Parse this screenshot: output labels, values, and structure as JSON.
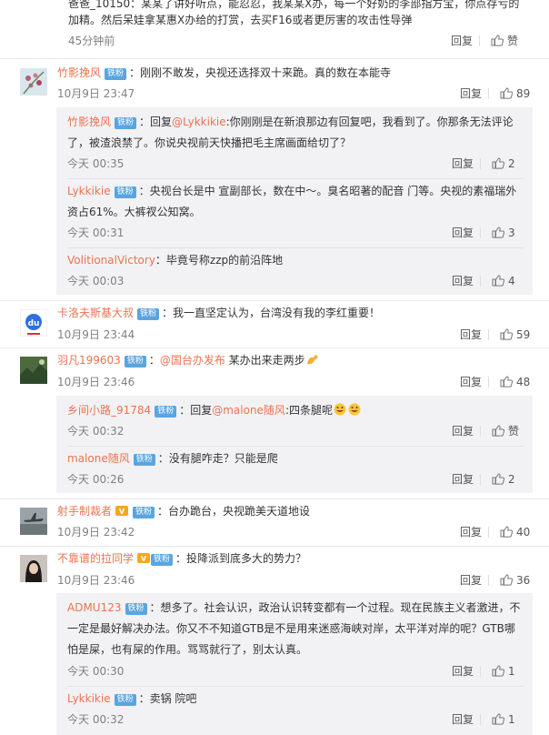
{
  "top": {
    "partial_text_1": "爸爸_10150：某某了讲好听点，能忍忍，我某某X办，每一个好奶的李部指方宝，你点存亏的",
    "partial_text_2": "加精。然后呆娃拿某惠X办给的打赏，去买F16或者更厉害的攻击性导弹",
    "time": "45分钟前",
    "reply": "回复",
    "like": "赞"
  },
  "comments": [
    {
      "name": "竹影挽风",
      "badge": "铁粉",
      "text": "：刚刚不敢发，央视还选择双十来跪。真的数在本能寺",
      "time": "10月9日 23:47",
      "reply": "回复",
      "likes": "89",
      "replies": [
        {
          "name": "竹影挽风",
          "badge": "铁粉",
          "pre": "：回复",
          "mention": "@Lykkikie",
          "text1": ":你刚刚是在新浪那边有回复吧，我看到了。你那条无法评论",
          "text2": "了，被渣浪禁了。你说央视前天快播把毛主席画面给切了？",
          "time": "今天 00:35",
          "reply": "回复",
          "likes": "2"
        },
        {
          "name": "Lykkikie",
          "badge": "铁粉",
          "text1": "：央视台长是中 宣副部长，数在中～。臭名昭著的配音 门等。央视的素福瑞外",
          "text2": "资占61%。大裤衩公知窝。",
          "time": "今天 00:31",
          "reply": "回复",
          "likes": "3"
        },
        {
          "name": "VolitionalVictory",
          "text1": "：毕竟号称zzp的前沿阵地",
          "time": "今天 00:03",
          "reply": "回复",
          "likes": "4"
        }
      ]
    },
    {
      "name": "卡洛夫斯基大叔",
      "badge": "铁粉",
      "text": "：我一直坚定认为，台湾没有我的李红重要！",
      "time": "10月9日 23:44",
      "reply": "回复",
      "likes": "59"
    },
    {
      "name": "羽凡199603",
      "badge": "铁粉",
      "pre": "：",
      "mention": "@国台办发布",
      "text": " 某办出来走两步",
      "time": "10月9日 23:46",
      "reply": "回复",
      "likes": "48",
      "replies": [
        {
          "name": "乡间小路_91784",
          "badge": "铁粉",
          "pre": "：回复",
          "mention": "@malone随风",
          "text1": ":四条腿呢",
          "time": "今天 00:32",
          "reply": "回复",
          "likes": "赞"
        },
        {
          "name": "malone随风",
          "badge": "铁粉",
          "text1": "：没有腿咋走？只能是爬",
          "time": "今天 00:26",
          "reply": "回复",
          "likes": "2"
        }
      ]
    },
    {
      "name": "射手制裁者",
      "badge": "铁粉",
      "text": "：台办跪台，央视跪美天道地设",
      "time": "10月9日 23:42",
      "reply": "回复",
      "likes": "40"
    },
    {
      "name": "不靠谱的拉同学",
      "badge": "铁粉",
      "text": "：投降派到底多大的势力？",
      "time": "10月9日 23:46",
      "reply": "回复",
      "likes": "36",
      "replies": [
        {
          "name": "ADMU123",
          "badge": "铁粉",
          "text1": "：想多了。社会认识，政治认识转变都有一个过程。现在民族主义者激进，不",
          "text2": "一定是最好解决办法。你又不不知道GTB是不是用来迷惑海峡对岸，太平洋对岸的呢？GTB哪",
          "text3": "怕是屎，也有屎的作用。骂骂就行了，别太认真。",
          "time": "今天 00:30",
          "reply": "回复",
          "likes": "1"
        },
        {
          "name": "Lykkikie",
          "badge": "铁粉",
          "text1": "：卖锅 院吧",
          "time": "今天 00:32",
          "reply": "回复",
          "likes": "1"
        }
      ]
    }
  ]
}
